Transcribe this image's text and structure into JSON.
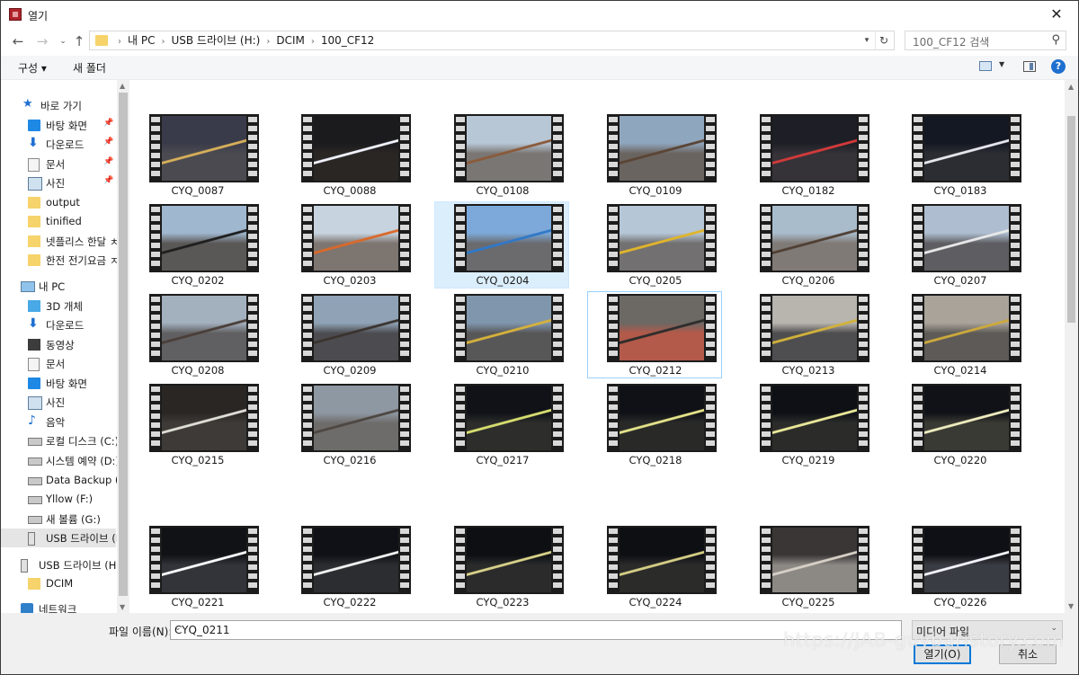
{
  "window": {
    "title": "열기",
    "close_glyph": "✕"
  },
  "address_bar": {
    "breadcrumbs": [
      "내 PC",
      "USB 드라이브 (H:)",
      "DCIM",
      "100_CF12"
    ],
    "search_placeholder": "100_CF12 검색"
  },
  "command_bar": {
    "organize_label": "구성 ▾",
    "new_folder_label": "새 폴더",
    "help_label": "?"
  },
  "nav_pane": {
    "items": [
      {
        "label": "바로 가기",
        "icon": "star-icon",
        "pinned": false
      },
      {
        "label": "바탕 화면",
        "icon": "desktop-icon",
        "pinned": true
      },
      {
        "label": "다운로드",
        "icon": "download-icon",
        "pinned": true
      },
      {
        "label": "문서",
        "icon": "document-icon",
        "pinned": true
      },
      {
        "label": "사진",
        "icon": "pictures-icon",
        "pinned": true
      },
      {
        "label": "output",
        "icon": "folder-icon",
        "pinned": false
      },
      {
        "label": "tinified",
        "icon": "folder-icon",
        "pinned": false
      },
      {
        "label": "넷플리스 한달 ㅊ",
        "icon": "folder-icon",
        "pinned": false
      },
      {
        "label": "한전 전기요금 ㅈ",
        "icon": "folder-icon",
        "pinned": false
      },
      {
        "label": "내 PC",
        "icon": "pc-icon",
        "pinned": false
      },
      {
        "label": "3D 개체",
        "icon": "3d-objects-icon",
        "pinned": false
      },
      {
        "label": "다운로드",
        "icon": "download-icon",
        "pinned": false
      },
      {
        "label": "동영상",
        "icon": "videos-icon",
        "pinned": false
      },
      {
        "label": "문서",
        "icon": "document-icon",
        "pinned": false
      },
      {
        "label": "바탕 화면",
        "icon": "desktop-icon",
        "pinned": false
      },
      {
        "label": "사진",
        "icon": "pictures-icon",
        "pinned": false
      },
      {
        "label": "음악",
        "icon": "music-icon",
        "pinned": false
      },
      {
        "label": "로컬 디스크 (C:)",
        "icon": "drive-icon",
        "pinned": false
      },
      {
        "label": "시스템 예약 (D:)",
        "icon": "drive-icon",
        "pinned": false
      },
      {
        "label": "Data Backup (E:)",
        "icon": "drive-icon",
        "pinned": false
      },
      {
        "label": "Yllow (F:)",
        "icon": "drive-icon",
        "pinned": false
      },
      {
        "label": "새 볼륨 (G:)",
        "icon": "drive-icon",
        "pinned": false
      },
      {
        "label": "USB 드라이브 (H:)",
        "icon": "usb-icon",
        "pinned": false
      },
      {
        "label": "USB 드라이브 (H:)",
        "icon": "usb-icon",
        "pinned": false
      },
      {
        "label": "DCIM",
        "icon": "folder-icon",
        "pinned": false
      },
      {
        "label": "네트워크",
        "icon": "network-icon",
        "pinned": false
      }
    ]
  },
  "files": [
    {
      "name": "CYQ_0087",
      "sky": "#3a3b4a",
      "ground": "#4a4a50",
      "accent": "#d8b05a"
    },
    {
      "name": "CYQ_0088",
      "sky": "#1b1b1d",
      "ground": "#2a2624",
      "accent": "#f2f4ff"
    },
    {
      "name": "CYQ_0108",
      "sky": "#b8c7d6",
      "ground": "#7a7673",
      "accent": "#8a5a3a"
    },
    {
      "name": "CYQ_0109",
      "sky": "#8fa6bf",
      "ground": "#6a6460",
      "accent": "#5a4434"
    },
    {
      "name": "CYQ_0182",
      "sky": "#1d1e26",
      "ground": "#353238",
      "accent": "#d43a3a"
    },
    {
      "name": "CYQ_0183",
      "sky": "#141822",
      "ground": "#2c2d33",
      "accent": "#e8e8f0"
    },
    {
      "name": "CYQ_0202",
      "sky": "#9fb7cf",
      "ground": "#5a5856",
      "accent": "#1e1e1e"
    },
    {
      "name": "CYQ_0203",
      "sky": "#c7d4df",
      "ground": "#7d7570",
      "accent": "#d9692a"
    },
    {
      "name": "CYQ_0204",
      "sky": "#7ca9d9",
      "ground": "#6b6b6e",
      "accent": "#2f78c9"
    },
    {
      "name": "CYQ_0205",
      "sky": "#b5c6d6",
      "ground": "#727070",
      "accent": "#e1b52a"
    },
    {
      "name": "CYQ_0206",
      "sky": "#a9bccc",
      "ground": "#807a76",
      "accent": "#4f3f33"
    },
    {
      "name": "CYQ_0207",
      "sky": "#aebdcf",
      "ground": "#5e5e62",
      "accent": "#e9e9e9"
    },
    {
      "name": "CYQ_0208",
      "sky": "#a3b0be",
      "ground": "#605f61",
      "accent": "#4a3e38"
    },
    {
      "name": "CYQ_0209",
      "sky": "#90a3b6",
      "ground": "#4c4c50",
      "accent": "#3a332e"
    },
    {
      "name": "CYQ_0210",
      "sky": "#7f96ad",
      "ground": "#585758",
      "accent": "#d6b13b"
    },
    {
      "name": "CYQ_0212",
      "sky": "#6c6864",
      "ground": "#b35a4a",
      "accent": "#2c2c2c"
    },
    {
      "name": "CYQ_0213",
      "sky": "#b8b4ae",
      "ground": "#4e4d4f",
      "accent": "#d2b23a"
    },
    {
      "name": "CYQ_0214",
      "sky": "#a9a39a",
      "ground": "#5d5a57",
      "accent": "#cda93c"
    },
    {
      "name": "CYQ_0215",
      "sky": "#2a2624",
      "ground": "#3e3a37",
      "accent": "#e0e0d8"
    },
    {
      "name": "CYQ_0216",
      "sky": "#8e98a3",
      "ground": "#6e6c6a",
      "accent": "#4d4641"
    },
    {
      "name": "CYQ_0217",
      "sky": "#101218",
      "ground": "#2d2e2b",
      "accent": "#d9e070"
    },
    {
      "name": "CYQ_0218",
      "sky": "#0f1116",
      "ground": "#292a28",
      "accent": "#e6e48a"
    },
    {
      "name": "CYQ_0219",
      "sky": "#0e1015",
      "ground": "#2b2c2a",
      "accent": "#ecea9a"
    },
    {
      "name": "CYQ_0220",
      "sky": "#101217",
      "ground": "#3a3a34",
      "accent": "#f0eec0"
    },
    {
      "name": "CYQ_0221",
      "sky": "#101216",
      "ground": "#33343a",
      "accent": "#ffffff"
    },
    {
      "name": "CYQ_0222",
      "sky": "#0f1116",
      "ground": "#2c2d31",
      "accent": "#f4f4f4"
    },
    {
      "name": "CYQ_0223",
      "sky": "#0d0f13",
      "ground": "#2a2b2a",
      "accent": "#d9d28a"
    },
    {
      "name": "CYQ_0224",
      "sky": "#0e0f13",
      "ground": "#2b2b2a",
      "accent": "#d6cf86"
    },
    {
      "name": "CYQ_0225",
      "sky": "#3a3636",
      "ground": "#8c8884",
      "accent": "#d6d0c6"
    },
    {
      "name": "CYQ_0226",
      "sky": "#0e1016",
      "ground": "#3a3c43",
      "accent": "#f6f6ff"
    }
  ],
  "footer": {
    "filename_label": "파일 이름(N):",
    "filename_value": "CYQ_0211",
    "filter_value": "미디어 파일",
    "open_label": "열기(O)",
    "cancel_label": "취소",
    "watermark": "https://JAB-guybaristory.com"
  }
}
